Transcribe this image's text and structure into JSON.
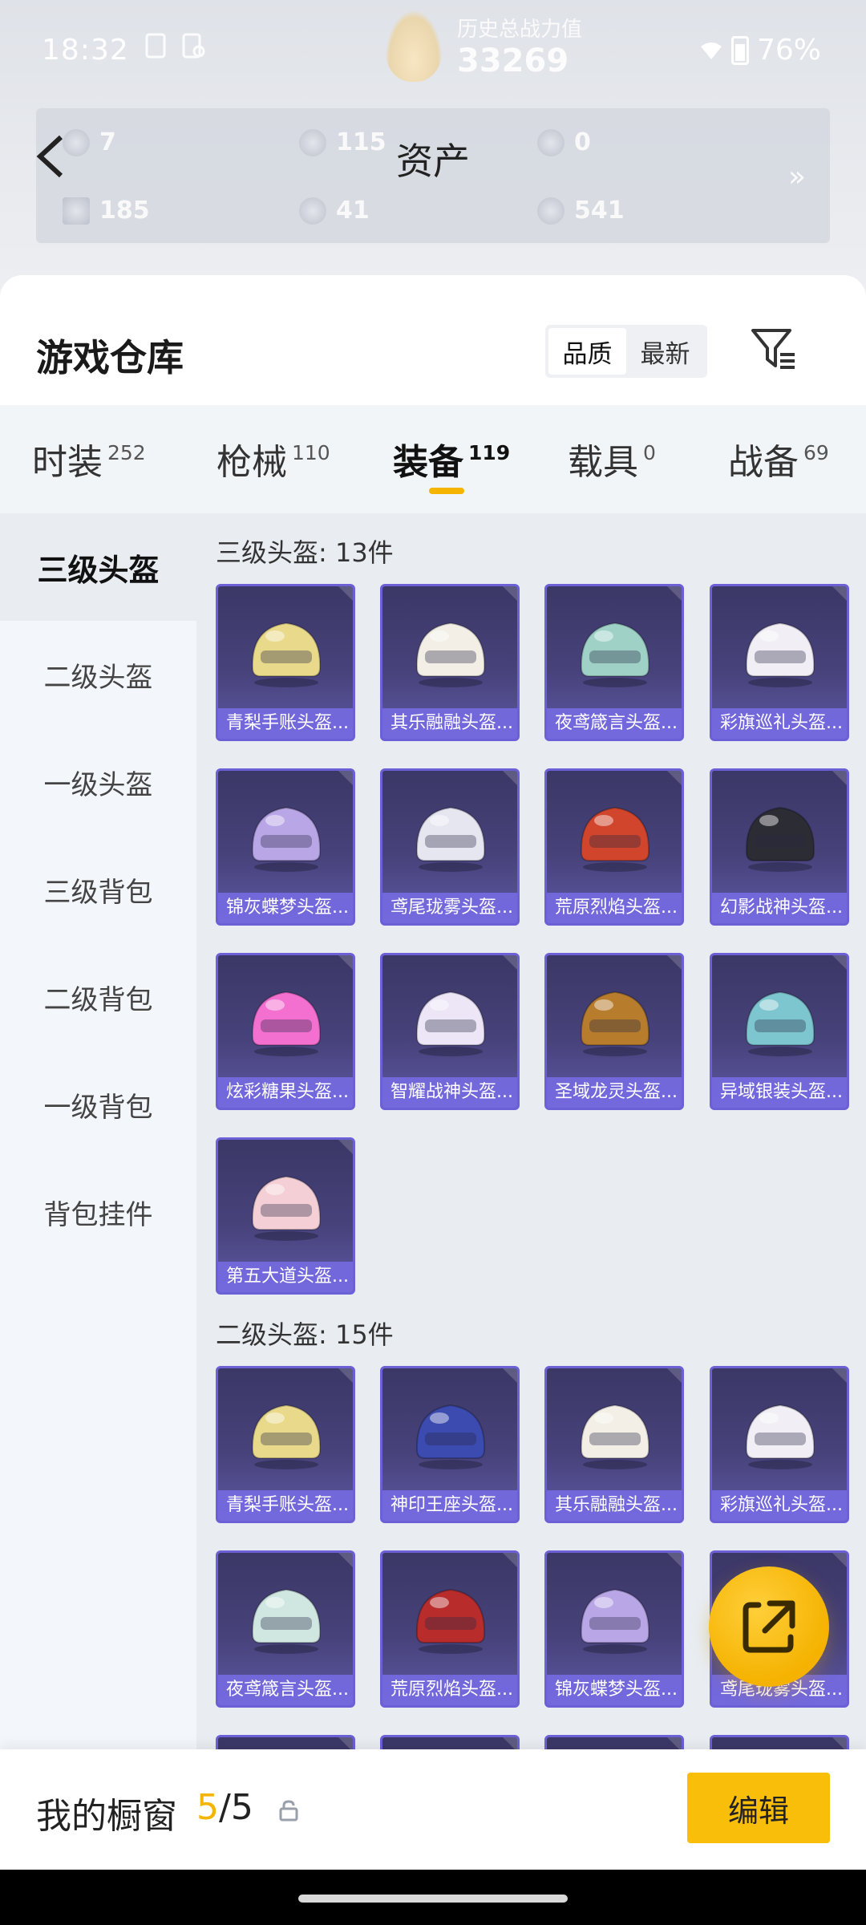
{
  "status": {
    "time": "18:32",
    "battery": "76%"
  },
  "header": {
    "power_label": "历史总战力值",
    "power_value": "33269",
    "title": "资产",
    "assets": [
      {
        "icon": "ticket-icon",
        "value": "7"
      },
      {
        "icon": "silver-coin-icon",
        "value": "115"
      },
      {
        "icon": "gold-coin-icon",
        "value": "0"
      },
      {
        "icon": "cash-icon",
        "value": "185"
      },
      {
        "icon": "orb-icon",
        "value": "41"
      },
      {
        "icon": "pearl-icon",
        "value": "541"
      }
    ],
    "more": "»"
  },
  "warehouse": {
    "title": "游戏仓库",
    "sort": [
      "品质",
      "最新"
    ],
    "tabs": [
      {
        "label": "时装",
        "count": "252"
      },
      {
        "label": "枪械",
        "count": "110"
      },
      {
        "label": "装备",
        "count": "119"
      },
      {
        "label": "载具",
        "count": "0"
      },
      {
        "label": "战备",
        "count": "69"
      }
    ],
    "sidebar": [
      "三级头盔",
      "二级头盔",
      "一级头盔",
      "三级背包",
      "二级背包",
      "一级背包",
      "背包挂件"
    ],
    "sections": [
      {
        "title": "三级头盔: 13件",
        "items": [
          "青梨手账头盔...",
          "其乐融融头盔...",
          "夜鸢箴言头盔...",
          "彩旗巡礼头盔...",
          "锦灰蝶梦头盔...",
          "鸢尾珑雾头盔...",
          "荒原烈焰头盔...",
          "幻影战神头盔...",
          "炫彩糖果头盔...",
          "智耀战神头盔...",
          "圣域龙灵头盔...",
          "异域银装头盔...",
          "第五大道头盔..."
        ]
      },
      {
        "title": "二级头盔: 15件",
        "items": [
          "青梨手账头盔...",
          "神印王座头盔...",
          "其乐融融头盔...",
          "彩旗巡礼头盔...",
          "夜鸢箴言头盔...",
          "荒原烈焰头盔...",
          "锦灰蝶梦头盔...",
          "鸢尾珑雾头盔..."
        ]
      }
    ]
  },
  "showcase": {
    "label": "我的橱窗",
    "current": "5",
    "total": "/5",
    "edit": "编辑"
  },
  "colors": {
    "accent": "#f9be0a",
    "card_border": "#6b60d6",
    "card_bg": "#3b3766"
  }
}
